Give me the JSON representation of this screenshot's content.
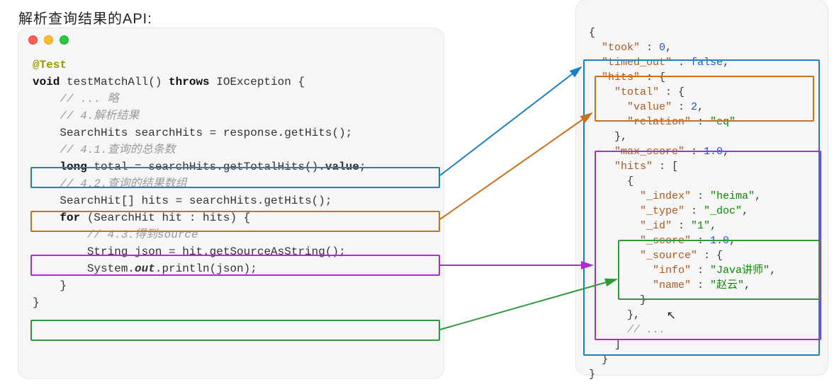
{
  "heading": "解析查询结果的API:",
  "left_code": {
    "annotation": "@Test",
    "line1_pre": "void",
    "line1_mid": " testMatchAll() ",
    "line1_throws": "throws",
    "line1_post": " IOException {",
    "line2": "    // ... 略",
    "line3": "    // 4.解析结果",
    "line4": "    SearchHits searchHits = response.getHits();",
    "line5": "    // 4.1.查询的总条数",
    "line6a": "    ",
    "line6b": "long",
    "line6c": " total = searchHits.getTotalHits().",
    "line6d": "value",
    "line6e": ";",
    "line7": "    // 4.2.查询的结果数组",
    "line8": "    SearchHit[] hits = searchHits.getHits();",
    "line9a": "    ",
    "line9b": "for",
    "line9c": " (SearchHit hit : hits) {",
    "line10": "        // 4.3.得到source",
    "line11": "        String json = hit.getSourceAsString();",
    "line12a": "        System.",
    "line12b": "out",
    "line12c": ".println(json);",
    "line13": "    }",
    "line14": "}"
  },
  "right_code": {
    "r1": "{",
    "r2a": "  \"took\"",
    "r2b": " : ",
    "r2c": "0",
    "r2d": ",",
    "r3a": "  \"timed_out\"",
    "r3b": " : ",
    "r3c": "false",
    "r3d": ",",
    "r4a": "  \"hits\"",
    "r4b": " : {",
    "r5a": "    \"total\"",
    "r5b": " : {",
    "r6a": "      \"value\"",
    "r6b": " : ",
    "r6c": "2",
    "r6d": ",",
    "r7a": "      \"relation\"",
    "r7b": " : ",
    "r7c": "\"eq\"",
    "r8": "    },",
    "r9a": "    \"max_score\"",
    "r9b": " : ",
    "r9c": "1.0",
    "r9d": ",",
    "r10a": "    \"hits\"",
    "r10b": " : [",
    "r11": "      {",
    "r12a": "        \"_index\"",
    "r12b": " : ",
    "r12c": "\"heima\"",
    "r12d": ",",
    "r13a": "        \"_type\"",
    "r13b": " : ",
    "r13c": "\"_doc\"",
    "r13d": ",",
    "r14a": "        \"_id\"",
    "r14b": " : ",
    "r14c": "\"1\"",
    "r14d": ",",
    "r15a": "        \"_score\"",
    "r15b": " : ",
    "r15c": "1.0",
    "r15d": ",",
    "r16a": "        \"_source\"",
    "r16b": " : {",
    "r17a": "          \"info\"",
    "r17b": " : ",
    "r17c": "\"Java讲师\"",
    "r17d": ",",
    "r18a": "          \"name\"",
    "r18b": " : ",
    "r18c": "\"赵云\"",
    "r18d": ",",
    "r19": "        }",
    "r20": "      },",
    "r21": "      // ...",
    "r22": "    ]",
    "r23": "  }",
    "r24": "}"
  }
}
